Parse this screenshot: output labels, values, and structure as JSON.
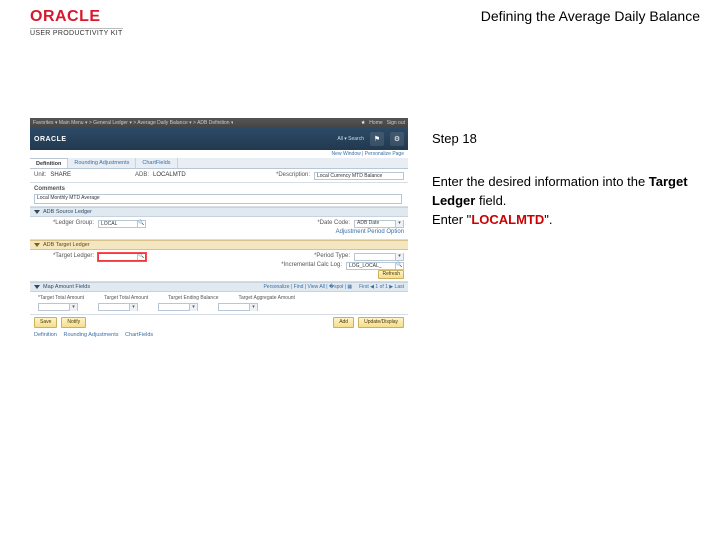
{
  "header": {
    "brand": "ORACLE",
    "product": "USER PRODUCTIVITY KIT",
    "title": "Defining the Average Daily Balance"
  },
  "instruction": {
    "step": "Step 18",
    "line1_a": "Enter the desired information into the ",
    "line1_b": "Target Ledger",
    "line1_c": " field.",
    "line2_a": "Enter \"",
    "line2_b": "LOCALMTD",
    "line2_c": "\"."
  },
  "shot": {
    "topbar": {
      "crumb": "Favorites ▾   Main Menu ▾   > General Ledger ▾  > Average Daily Balance ▾  > ADB Definition ▾",
      "home": "Home",
      "signout": "Sign out",
      "star": "★"
    },
    "orabar": {
      "logo": "ORACLE",
      "sub": "All ▾   Search",
      "flag_icon": "⚑",
      "gear_icon": "⚙"
    },
    "linkrow": "New Window | Personalize Page",
    "tabs": {
      "t1": "Definition",
      "t2": "Rounding Adjustments",
      "t3": "ChartFields"
    },
    "def": {
      "unit_lbl": "Unit:",
      "unit_val": "SHARE",
      "adb_lbl": "ADB:",
      "adb_val": "LOCALMTD",
      "desc_lbl": "*Description:",
      "desc_val": "Local Currency MTD Balance"
    },
    "comments": {
      "head": "Comments",
      "val": "Local Monthly MTD Average"
    },
    "source": {
      "head": "ADB Source Ledger",
      "ledger_lbl": "*Ledger Group:",
      "ledger_val": "LOCAL",
      "date_lbl": "*Date Code:",
      "date_val": "ADB Date",
      "adj_lbl": "Adjustment Period Option"
    },
    "target": {
      "head": "ADB Target Ledger",
      "ledger_lbl": "*Target Ledger:",
      "ledger_val": "",
      "period_lbl": "*Period Type:",
      "incr_lbl": "*Incremental Calc Log:",
      "incr_val": "LOG_LOCAL_",
      "refresh": "Refresh"
    },
    "map": {
      "head": "Map Amount Fields",
      "pers": "Personalize | Find | View All | �społ | ▦",
      "count": "First ◀ 1 of 1 ▶ Last",
      "c1": "*Target Total Amount",
      "c2": "Target Total Amount",
      "c3": "Target Ending Balance",
      "c4": "Target Aggregate Amount",
      "add": "Add",
      "update": "Update/Display"
    },
    "foot": {
      "save": "Save",
      "notify": "Notify"
    },
    "bottom": {
      "l1": "Definition",
      "l2": "Rounding Adjustments",
      "l3": "ChartFields"
    }
  }
}
